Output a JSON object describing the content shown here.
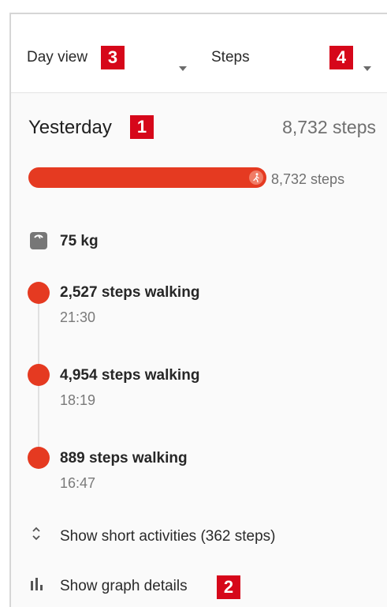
{
  "header": {
    "view_label": "Day view",
    "view_badge": "3",
    "metric_label": "Steps",
    "metric_badge": "4"
  },
  "summary": {
    "title": "Yesterday",
    "title_badge": "1",
    "total": "8,732 steps",
    "progress_caption": "8,732 steps",
    "progress_fraction": 1.0
  },
  "weight": {
    "value": "75 kg",
    "icon": "scale-icon"
  },
  "activities": [
    {
      "label": "2,527 steps walking",
      "time": "21:30"
    },
    {
      "label": "4,954 steps walking",
      "time": "18:19"
    },
    {
      "label": "889 steps walking",
      "time": "16:47"
    }
  ],
  "links": {
    "short_activities": "Show short activities (362 steps)",
    "graph_details": "Show graph details",
    "graph_badge": "2"
  },
  "colors": {
    "accent": "#e53a21",
    "badge": "#d6071a"
  }
}
